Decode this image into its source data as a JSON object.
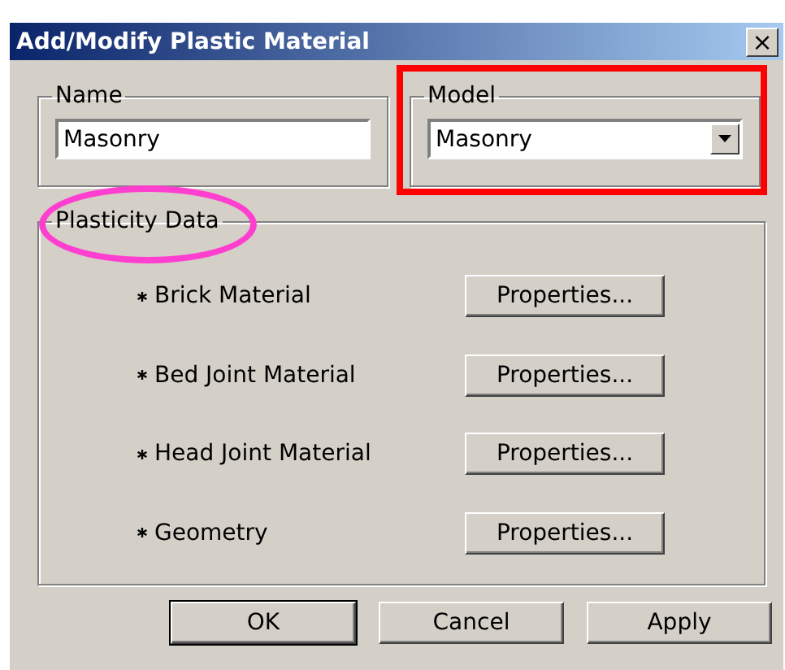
{
  "window": {
    "title": "Add/Modify Plastic Material",
    "close": "×"
  },
  "name_group": {
    "legend": "Name",
    "value": "Masonry"
  },
  "model_group": {
    "legend": "Model",
    "value": "Masonry"
  },
  "plasticity_group": {
    "legend": "Plasticity Data",
    "rows": [
      {
        "label": "Brick Material",
        "button": "Properties..."
      },
      {
        "label": "Bed Joint Material",
        "button": "Properties..."
      },
      {
        "label": "Head Joint Material",
        "button": "Properties..."
      },
      {
        "label": "Geometry",
        "button": "Properties..."
      }
    ]
  },
  "buttons": [
    {
      "label": "OK",
      "default": true
    },
    {
      "label": "Cancel",
      "default": false
    },
    {
      "label": "Apply",
      "default": false
    }
  ],
  "annotations": [
    {
      "kind": "rectangle",
      "color": "#ff0000"
    },
    {
      "kind": "ellipse",
      "color": "#ff3fcf"
    }
  ]
}
